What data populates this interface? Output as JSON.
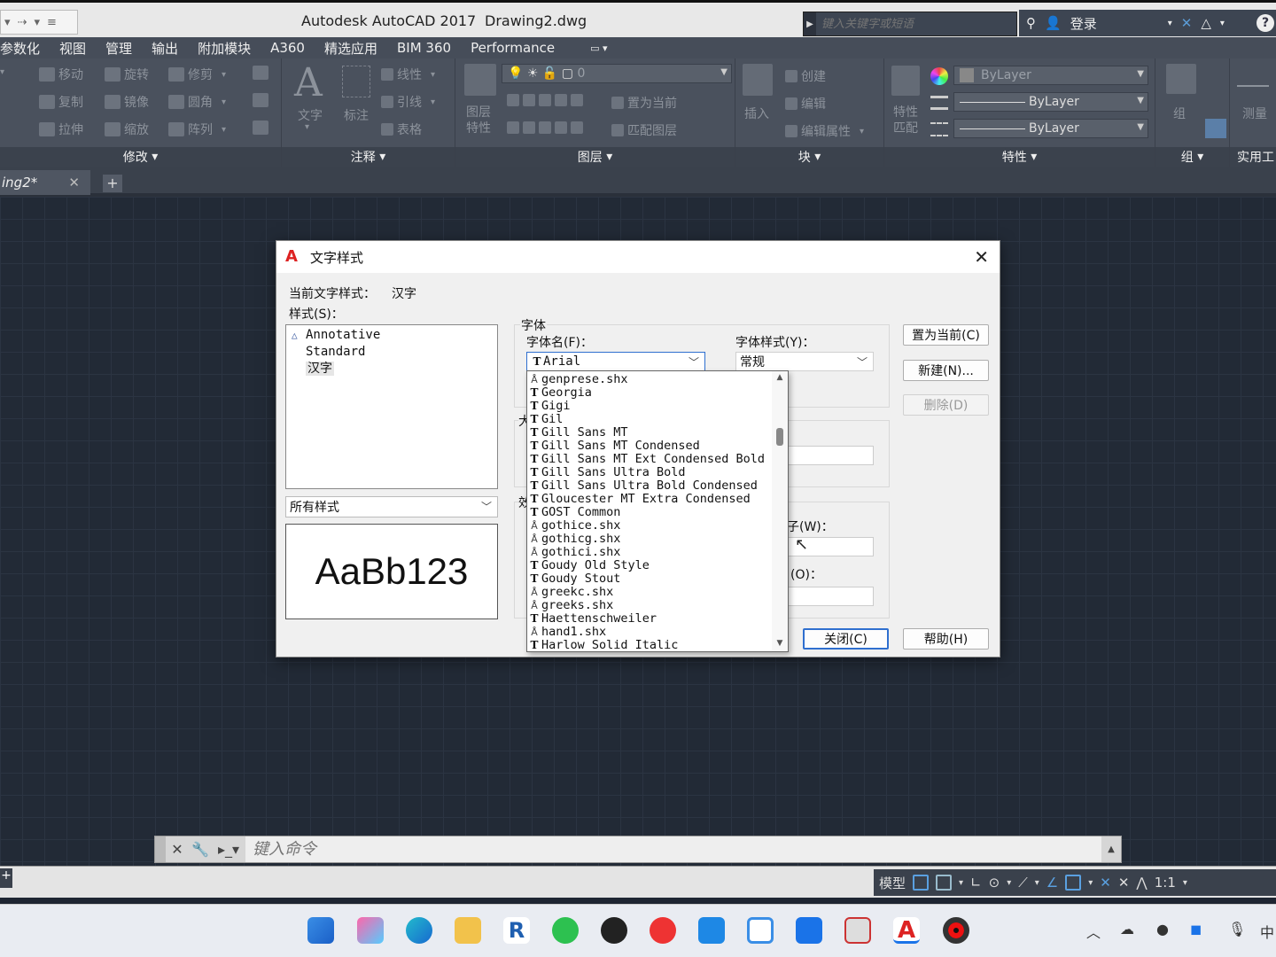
{
  "titlebar": {
    "app_title": "Autodesk AutoCAD 2017",
    "doc_title": "Drawing2.dwg",
    "search_placeholder": "键入关键字或短语",
    "login_label": "登录"
  },
  "menu": [
    "参数化",
    "视图",
    "管理",
    "输出",
    "附加模块",
    "A360",
    "精选应用",
    "BIM 360",
    "Performance"
  ],
  "ribbon": {
    "modify": {
      "title": "修改",
      "commands": [
        "移动",
        "旋转",
        "修剪",
        "复制",
        "镜像",
        "圆角",
        "拉伸",
        "缩放",
        "阵列"
      ]
    },
    "annotation": {
      "title": "注释",
      "big_buttons": [
        "文字",
        "标注"
      ],
      "commands": [
        "线性",
        "引线",
        "表格"
      ]
    },
    "layers": {
      "title": "图层",
      "big_button": "图层特性",
      "big_button_lines": [
        "图层",
        "特性"
      ],
      "layer_value": "0",
      "commands": [
        "置为当前",
        "匹配图层"
      ]
    },
    "block": {
      "title": "块",
      "big_button": "插入",
      "commands": [
        "创建",
        "编辑",
        "编辑属性"
      ]
    },
    "properties": {
      "title": "特性",
      "big_button_lines": [
        "特性",
        "匹配"
      ],
      "color_value": "ByLayer",
      "linetype_value": "ByLayer",
      "lineweight_value": "ByLayer"
    },
    "group": {
      "title": "组",
      "big_button": "组"
    },
    "utilities": {
      "title": "实用工",
      "big_button": "测量"
    }
  },
  "doc_tab": {
    "label": "ing2*",
    "close": "✕",
    "new": "+"
  },
  "dialog": {
    "title": "文字样式",
    "current_style_label": "当前文字样式：",
    "current_style_value": "汉字",
    "styles_label": "样式(S)：",
    "styles": [
      {
        "name": "Annotative",
        "annotative": true
      },
      {
        "name": "Standard",
        "annotative": false
      },
      {
        "name": "汉字",
        "annotative": false,
        "selected": true
      }
    ],
    "filter_value": "所有样式",
    "preview_text": "AaBb123",
    "font_group_label": "字体",
    "font_name_label": "字体名(F)：",
    "font_name_value": "Arial",
    "font_style_label": "字体样式(Y)：",
    "font_style_value": "常规",
    "size_group_partial": "大",
    "effects_group_partial": "效",
    "width_label_partial": "子(W)：",
    "oblique_label_partial": "(O)：",
    "buttons": {
      "set_current": "置为当前(C)",
      "new": "新建(N)...",
      "delete": "删除(D)",
      "close": "关闭(C)",
      "help": "帮助(H)"
    },
    "font_list": [
      {
        "name": "genprese.shx",
        "type": "shx"
      },
      {
        "name": "Georgia",
        "type": "tt"
      },
      {
        "name": "Gigi",
        "type": "tt"
      },
      {
        "name": "Gil",
        "type": "tt"
      },
      {
        "name": "Gill Sans MT",
        "type": "tt"
      },
      {
        "name": "Gill Sans MT Condensed",
        "type": "tt"
      },
      {
        "name": "Gill Sans MT Ext Condensed Bold",
        "type": "tt"
      },
      {
        "name": "Gill Sans Ultra Bold",
        "type": "tt"
      },
      {
        "name": "Gill Sans Ultra Bold Condensed",
        "type": "tt"
      },
      {
        "name": "Gloucester MT Extra Condensed",
        "type": "tt"
      },
      {
        "name": "GOST Common",
        "type": "tt"
      },
      {
        "name": "gothice.shx",
        "type": "shx"
      },
      {
        "name": "gothicg.shx",
        "type": "shx"
      },
      {
        "name": "gothici.shx",
        "type": "shx"
      },
      {
        "name": "Goudy Old Style",
        "type": "tt"
      },
      {
        "name": "Goudy Stout",
        "type": "tt"
      },
      {
        "name": "greekc.shx",
        "type": "shx"
      },
      {
        "name": "greeks.shx",
        "type": "shx"
      },
      {
        "name": "Haettenschweiler",
        "type": "tt"
      },
      {
        "name": "hand1.shx",
        "type": "shx"
      },
      {
        "name": "Harlow Solid Italic",
        "type": "tt"
      }
    ]
  },
  "commandline": {
    "placeholder": "键入命令"
  },
  "statusbar": {
    "model_label": "模型",
    "scale_label": "1:1"
  },
  "taskbar": {
    "tray_lang": "中"
  }
}
